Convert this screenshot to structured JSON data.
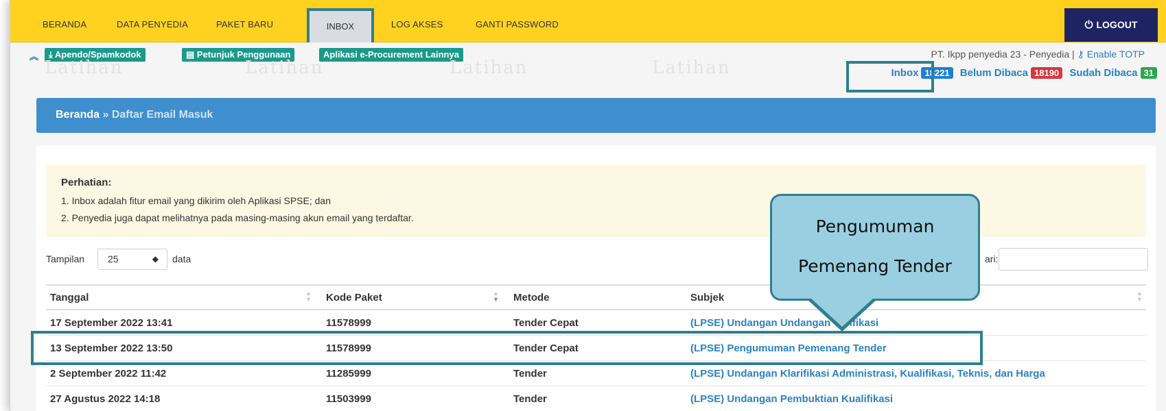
{
  "nav": {
    "items": [
      "BERANDA",
      "DATA PENYEDIA",
      "PAKET BARU",
      "INBOX",
      "LOG AKSES",
      "GANTI PASSWORD"
    ],
    "logout_label": "LOGOUT",
    "accent": "#ffd21f"
  },
  "toolbar": {
    "buttons": [
      "Apendo/Spamkodok",
      "Petunjuk Penggunaan",
      "Aplikasi e-Procurement Lainnya"
    ],
    "user_info": "PT. Ikpp penyedia 23 - Penyedia |",
    "totp_label": "Enable TOTP",
    "watermark": "Latihan"
  },
  "counters": {
    "inbox_label": "Inbox",
    "inbox_count": "18221",
    "inbox_color": "#1e7fd6",
    "unread_label": "Belum Dibaca",
    "unread_count": "18190",
    "unread_color": "#d9363e",
    "read_label": "Sudah Dibaca",
    "read_count": "31",
    "read_color": "#2aa84a"
  },
  "breadcrumb": {
    "home": "Beranda",
    "sep": "»",
    "current": "Daftar Email Masuk"
  },
  "notice": {
    "title": "Perhatian:",
    "lines": [
      "1. Inbox adalah fitur email yang dikirim oleh Aplikasi SPSE; dan",
      "2. Penyedia juga dapat melihatnya pada masing-masing akun email yang terdaftar."
    ]
  },
  "length": {
    "prefix": "Tampilan",
    "value": "25",
    "suffix": "data"
  },
  "search": {
    "label": "ari:",
    "value": ""
  },
  "table": {
    "columns": [
      "Tanggal",
      "Kode Paket",
      "Metode",
      "Subjek"
    ],
    "rows": [
      {
        "tanggal": "17 September 2022 13:41",
        "kode": "11578999",
        "metode": "Tender Cepat",
        "subjek": "(LPSE) Undangan Undangan Verifikasi"
      },
      {
        "tanggal": "13 September 2022 13:50",
        "kode": "11578999",
        "metode": "Tender Cepat",
        "subjek": "(LPSE) Pengumuman Pemenang Tender"
      },
      {
        "tanggal": "2 September 2022 11:42",
        "kode": "11285999",
        "metode": "Tender",
        "subjek": "(LPSE) Undangan Klarifikasi Administrasi, Kualifikasi, Teknis, dan Harga"
      },
      {
        "tanggal": "27 Agustus 2022 14:18",
        "kode": "11503999",
        "metode": "Tender",
        "subjek": "(LPSE) Undangan Pembuktian Kualifikasi"
      }
    ]
  },
  "callout": {
    "line1": "Pengumuman",
    "line2": "Pemenang Tender"
  }
}
